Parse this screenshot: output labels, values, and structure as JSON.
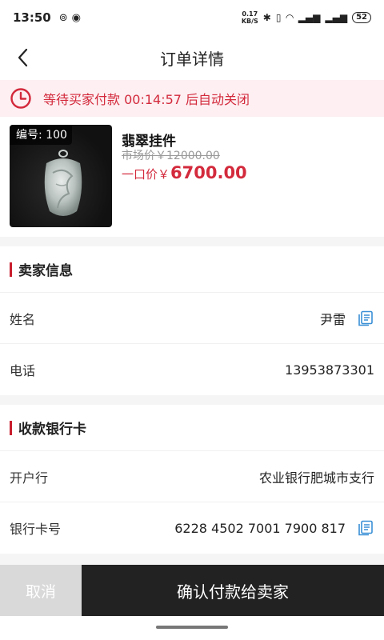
{
  "status_bar": {
    "time": "13:50",
    "net_speed_value": "0.17",
    "net_speed_unit": "KB/S",
    "battery": "52"
  },
  "nav": {
    "title": "订单详情"
  },
  "countdown": {
    "text": "等待买家付款 00:14:57 后自动关闭"
  },
  "product": {
    "code_label": "编号: 100",
    "name": "翡翠挂件",
    "market_price": "市场价￥12000.00",
    "fixed_price_label": "一口价￥",
    "fixed_price_value": "6700.00"
  },
  "seller": {
    "title": "卖家信息",
    "name_label": "姓名",
    "name_value": "尹雷",
    "phone_label": "电话",
    "phone_value": "13953873301"
  },
  "bank": {
    "title": "收款银行卡",
    "bank_label": "开户行",
    "bank_value": "农业银行肥城市支行",
    "card_label": "银行卡号",
    "card_value": "6228 4502 7001 7900 817"
  },
  "actions": {
    "cancel": "取消",
    "confirm": "确认付款给卖家"
  },
  "colors": {
    "accent": "#d32a3c",
    "banner_bg": "#fdeff2",
    "confirm_bg": "#222222"
  }
}
